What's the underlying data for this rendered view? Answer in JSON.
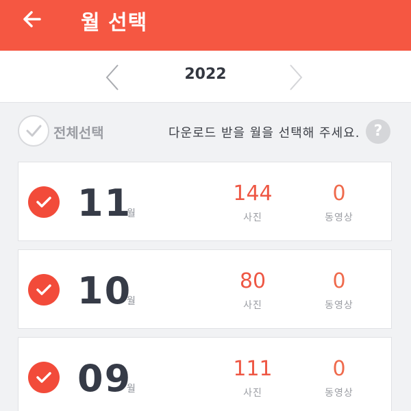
{
  "header": {
    "title": "월 선택",
    "back_icon": "arrow-left-icon",
    "background": "#f55742"
  },
  "year_nav": {
    "year": "2022",
    "prev_icon": "chevron-left-icon",
    "next_icon": "chevron-right-icon"
  },
  "toolbar": {
    "select_all_label": "전체선택",
    "guide_text": "다운로드 받을 월을 선택해 주세요.",
    "help_label": "?"
  },
  "months": [
    {
      "month": "11",
      "unit": "월",
      "photos": "144",
      "photos_label": "사진",
      "videos": "0",
      "videos_label": "동영상",
      "selected": true
    },
    {
      "month": "10",
      "unit": "월",
      "photos": "80",
      "photos_label": "사진",
      "videos": "0",
      "videos_label": "동영상",
      "selected": true
    },
    {
      "month": "09",
      "unit": "월",
      "photos": "111",
      "photos_label": "사진",
      "videos": "0",
      "videos_label": "동영상",
      "selected": true
    }
  ],
  "colors": {
    "accent": "#f24b3a",
    "count": "#ee5744",
    "text": "#363b47"
  }
}
